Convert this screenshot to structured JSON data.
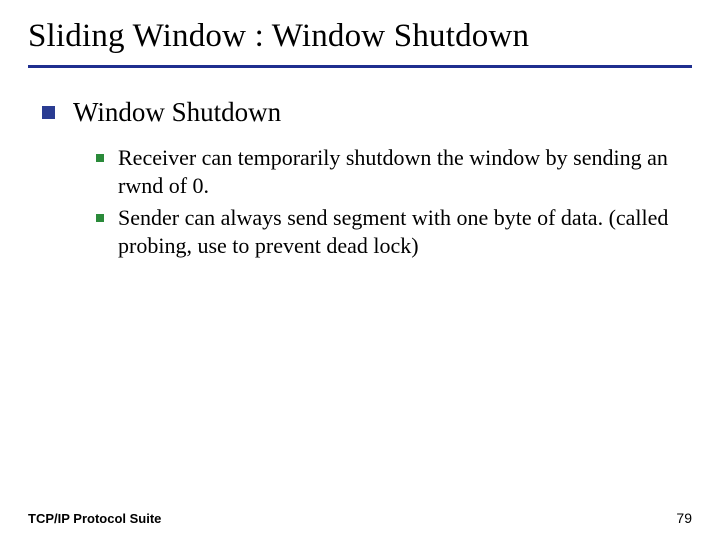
{
  "title": "Sliding Window : Window Shutdown",
  "bullets": {
    "heading": "Window Shutdown",
    "items": [
      "Receiver can temporarily shutdown the window by sending an rwnd of 0.",
      "Sender can always send segment with one byte of data. (called probing, use to prevent dead lock)"
    ]
  },
  "footer": {
    "source": "TCP/IP Protocol Suite",
    "page": "79"
  },
  "colors": {
    "rule": "#1f2f8f",
    "bullet_l1": "#2a3c92",
    "bullet_l2": "#2a8a3a"
  }
}
